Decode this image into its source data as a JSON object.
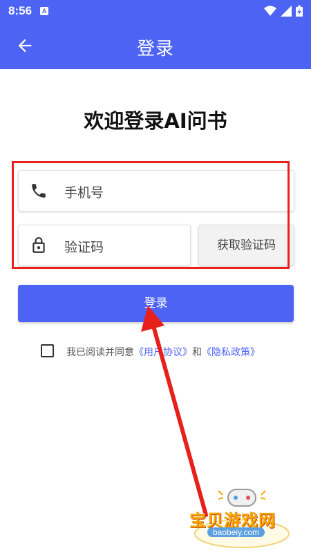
{
  "status_bar": {
    "time": "8:56",
    "notification_glyph": "A",
    "icons": [
      "wifi-icon",
      "signal-icon",
      "battery-charging-icon"
    ]
  },
  "app_bar": {
    "title": "登录",
    "back_icon": "arrow-left-icon"
  },
  "welcome_title": "欢迎登录AI问书",
  "form": {
    "phone": {
      "icon": "phone-icon",
      "placeholder": "手机号"
    },
    "code": {
      "icon": "lock-icon",
      "placeholder": "验证码"
    },
    "get_code_label": "获取验证码"
  },
  "login_label": "登录",
  "agreement": {
    "checked": false,
    "prefix": "我已阅读并同意",
    "user_agreement": "《用户协议》",
    "and": "和",
    "privacy_policy": "《隐私政策》"
  },
  "watermark": {
    "name": "宝贝游戏网",
    "url": "baobeiy.com"
  },
  "colors": {
    "primary": "#4d63f4",
    "annotation_red": "#e8201c",
    "link": "#4d63f4"
  }
}
